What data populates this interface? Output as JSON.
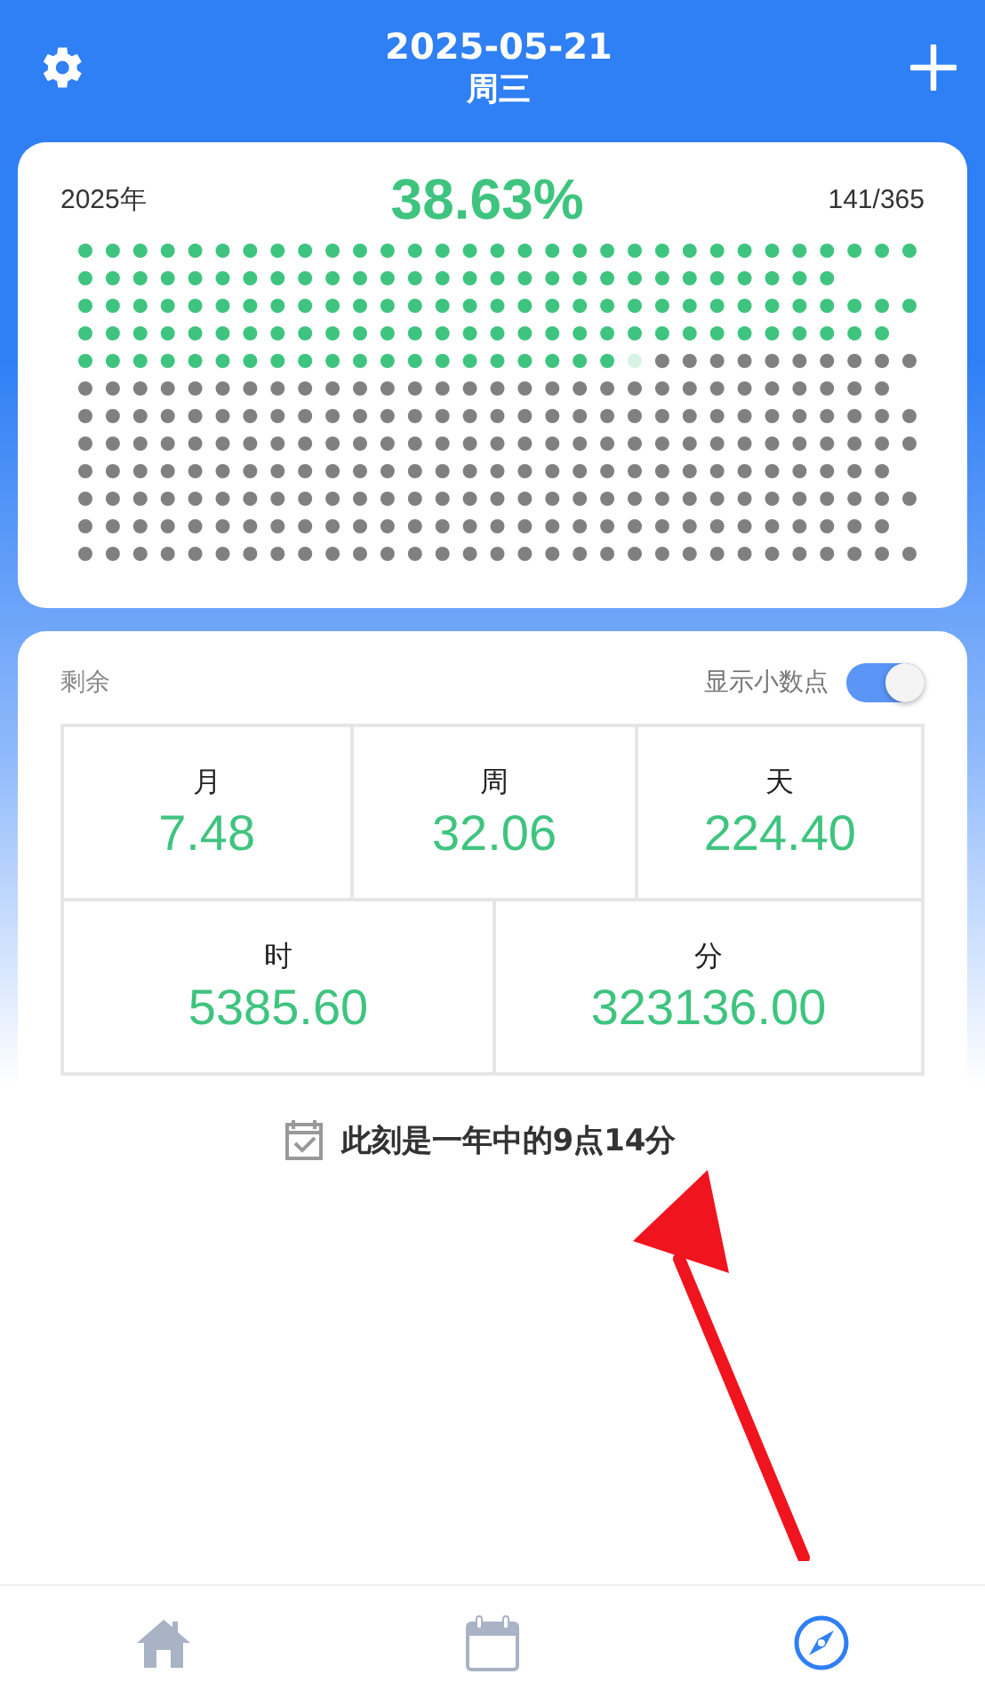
{
  "header": {
    "date": "2025-05-21",
    "weekday": "周三"
  },
  "year": {
    "label": "2025年",
    "percent": "38.63%",
    "fraction": "141/365"
  },
  "remaining": {
    "title": "剩余",
    "toggle_label": "显示小数点",
    "toggle_on": true,
    "cells": [
      {
        "unit": "月",
        "value": "7.48"
      },
      {
        "unit": "周",
        "value": "32.06"
      },
      {
        "unit": "天",
        "value": "224.40"
      },
      {
        "unit": "时",
        "value": "5385.60"
      },
      {
        "unit": "分",
        "value": "323136.00"
      }
    ]
  },
  "moment": "此刻是一年中的9点14分",
  "tabs": [
    {
      "kind": "home",
      "selected": false
    },
    {
      "kind": "calendar",
      "selected": false
    },
    {
      "kind": "compass",
      "selected": true
    }
  ]
}
